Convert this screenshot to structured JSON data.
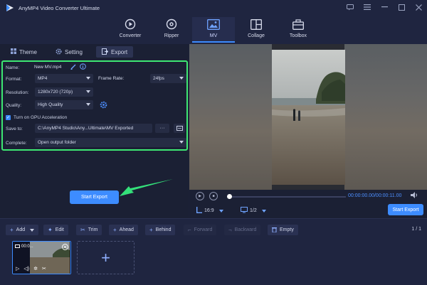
{
  "app": {
    "title": "AnyMP4 Video Converter Ultimate"
  },
  "titlebar": {
    "icons": [
      "feedback-icon",
      "menu-icon",
      "minimize-icon",
      "maximize-icon",
      "close-icon"
    ]
  },
  "nav": {
    "items": [
      {
        "label": "Converter",
        "icon": "converter-icon"
      },
      {
        "label": "Ripper",
        "icon": "ripper-icon"
      },
      {
        "label": "MV",
        "icon": "mv-icon",
        "active": true
      },
      {
        "label": "Collage",
        "icon": "collage-icon"
      },
      {
        "label": "Toolbox",
        "icon": "toolbox-icon"
      }
    ]
  },
  "tabs": {
    "theme": "Theme",
    "setting": "Setting",
    "export": "Export"
  },
  "export_settings": {
    "name_label": "Name:",
    "name_value": "New MV.mp4",
    "format_label": "Format:",
    "format_value": "MP4",
    "frame_rate_label": "Frame Rate:",
    "frame_rate_value": "24fps",
    "resolution_label": "Resolution:",
    "resolution_value": "1280x720 (720p)",
    "quality_label": "Quality:",
    "quality_value": "High Quality",
    "gpu_label": "Turn on GPU Acceleration",
    "save_to_label": "Save to:",
    "save_to_value": "C:\\AnyMP4 Studio\\Any...Ultimate\\MV Exported",
    "browse_label": "···",
    "complete_label": "Complete:",
    "complete_value": "Open output folder"
  },
  "start_export_label": "Start Export",
  "player": {
    "time": "00:00:00.00/00:00:11.00",
    "aspect": "16:9",
    "page": "1/2",
    "export_label": "Start Export"
  },
  "toolbar": {
    "add": "Add",
    "edit": "Edit",
    "trim": "Trim",
    "ahead": "Ahead",
    "behind": "Behind",
    "forward": "Forward",
    "backward": "Backward",
    "empty": "Empty",
    "page_indicator": "1 / 1"
  },
  "clip": {
    "duration": "00:0...",
    "add_symbol": "+"
  },
  "colors": {
    "accent": "#3d8cff",
    "highlight": "#3ee873",
    "background": "#1c2136"
  }
}
